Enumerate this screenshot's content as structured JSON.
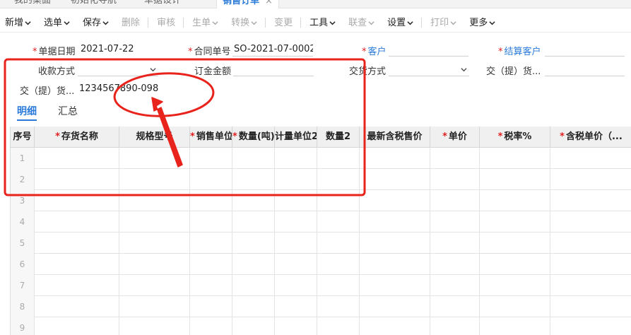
{
  "tabs": [
    {
      "label": "我的桌面"
    },
    {
      "label": "初始化导航"
    },
    {
      "label": "单据设计"
    },
    {
      "label": "销售订单",
      "active": true
    }
  ],
  "tab_close": "×",
  "toolbar": {
    "new": "新增",
    "select": "选单",
    "save": "保存",
    "delete": "删除",
    "audit": "审核",
    "generate": "生单",
    "convert": "转换",
    "change": "变更",
    "tools": "工具",
    "query": "联查",
    "settings": "设置",
    "print": "打印",
    "more": "更多"
  },
  "form": {
    "doc_date": {
      "label": "单据日期",
      "value": "2021-07-22"
    },
    "contract_no": {
      "label": "合同单号",
      "value": "SO-2021-07-0002"
    },
    "customer": {
      "label": "客户",
      "value": ""
    },
    "settle_customer": {
      "label": "结算客户",
      "value": ""
    },
    "payment_method": {
      "label": "收款方式",
      "value": ""
    },
    "deposit_amount": {
      "label": "订金金额",
      "value": ""
    },
    "delivery_method": {
      "label": "交货方式",
      "value": ""
    },
    "delivery_place_1": {
      "label": "交（提）货...",
      "value": ""
    },
    "delivery_place_2": {
      "label": "交（提）货...",
      "value": "1234567890-098..."
    }
  },
  "subtabs": {
    "detail": "明细",
    "summary": "汇总"
  },
  "grid": {
    "columns": [
      {
        "label": "序号",
        "required": false
      },
      {
        "label": "存货名称",
        "required": true
      },
      {
        "label": "规格型号",
        "required": false
      },
      {
        "label": "销售单位",
        "required": true
      },
      {
        "label": "数量(吨)",
        "required": true
      },
      {
        "label": "计量单位2",
        "required": false
      },
      {
        "label": "数量2",
        "required": false
      },
      {
        "label": "最新含税售价",
        "required": false
      },
      {
        "label": "单价",
        "required": true
      },
      {
        "label": "税率%",
        "required": true
      },
      {
        "label": "含税单价（...",
        "required": true
      }
    ],
    "row_numbers": [
      "1",
      "2",
      "3",
      "4",
      "5",
      "6",
      "7",
      "8",
      "9"
    ]
  },
  "annotation_color": "#e8231c",
  "accent_color": "#2a7ad9"
}
